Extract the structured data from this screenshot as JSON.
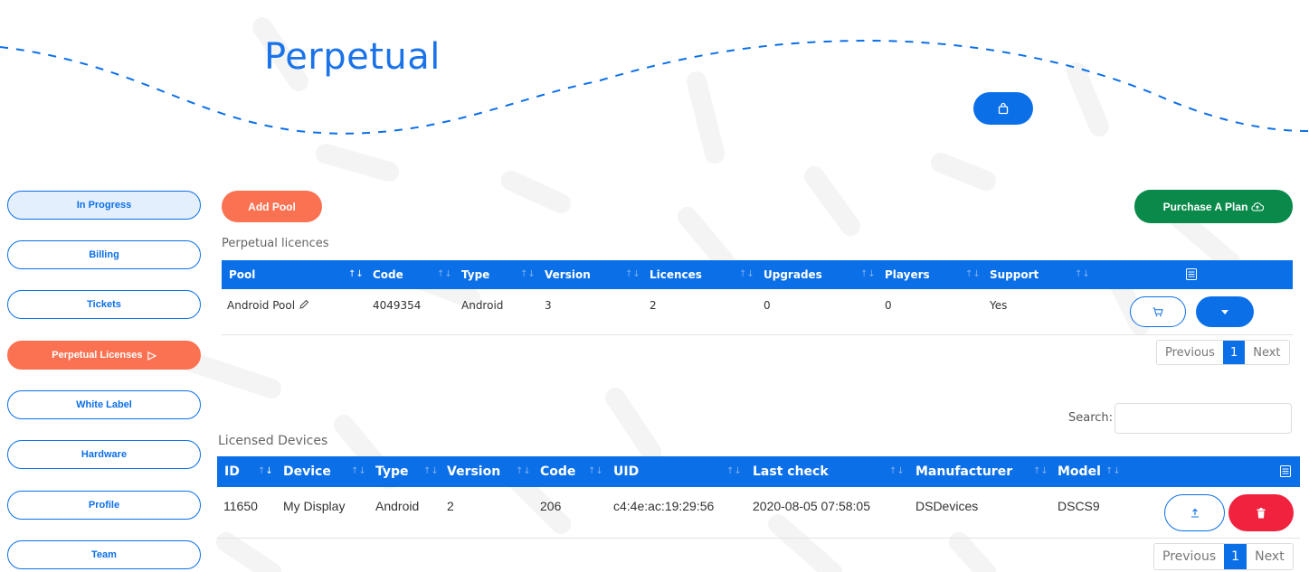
{
  "page": {
    "title": "Perpetual"
  },
  "header": {
    "bag_icon": "shopping-bag-icon"
  },
  "sidebar": {
    "items": [
      {
        "label": "In Progress"
      },
      {
        "label": "Billing"
      },
      {
        "label": "Tickets"
      },
      {
        "label": "Perpetual Licenses"
      },
      {
        "label": "White Label"
      },
      {
        "label": "Hardware"
      },
      {
        "label": "Profile"
      },
      {
        "label": "Team"
      }
    ],
    "active_arrow": "▷"
  },
  "toolbar": {
    "add_pool_label": "Add Pool",
    "purchase_label": "Purchase A Plan"
  },
  "licences": {
    "caption": "Perpetual licences",
    "columns": [
      "Pool",
      "Code",
      "Type",
      "Version",
      "Licences",
      "Upgrades",
      "Players",
      "Support"
    ],
    "rows": [
      {
        "pool": "Android Pool",
        "code": "4049354",
        "type": "Android",
        "version": "3",
        "licences": "2",
        "upgrades": "0",
        "players": "0",
        "support": "Yes"
      }
    ],
    "pager": {
      "previous": "Previous",
      "current": "1",
      "next": "Next"
    }
  },
  "devices": {
    "search_label": "Search:",
    "search_value": "",
    "caption": "Licensed Devices",
    "columns": [
      "ID",
      "Device",
      "Type",
      "Version",
      "Code",
      "UID",
      "Last check",
      "Manufacturer",
      "Model"
    ],
    "rows": [
      {
        "id": "11650",
        "device": "My Display",
        "type": "Android",
        "version": "2",
        "code": "206",
        "uid": "c4:4e:ac:19:29:56",
        "last_check": "2020-08-05 07:58:05",
        "manufacturer": "DSDevices",
        "model": "DSCS9"
      }
    ],
    "pager": {
      "previous": "Previous",
      "current": "1",
      "next": "Next"
    }
  },
  "colors": {
    "primary": "#0b6fe8",
    "accent": "#fa7252",
    "success": "#0a8a4a",
    "danger": "#f0223e"
  }
}
